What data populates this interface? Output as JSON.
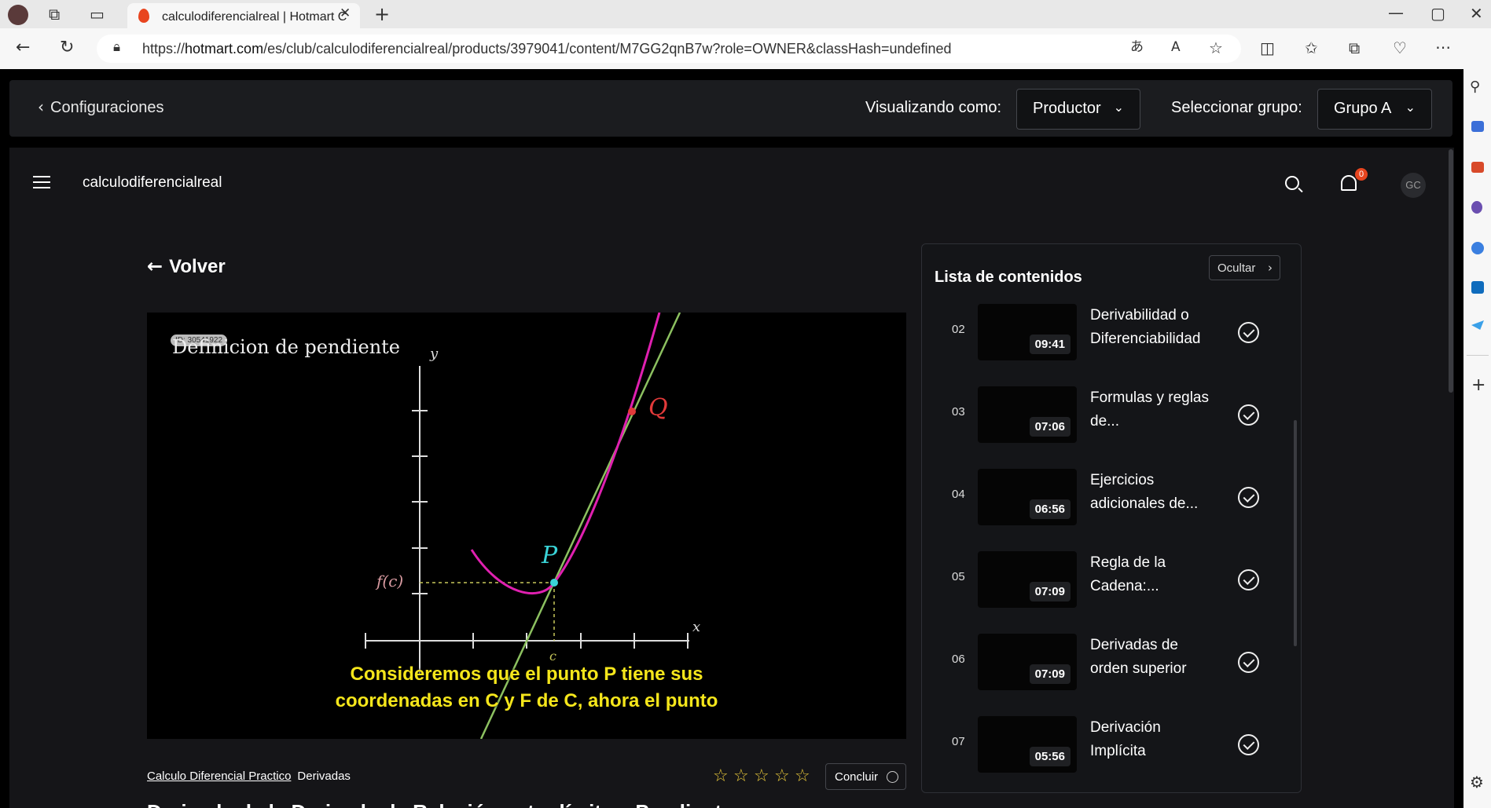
{
  "browser": {
    "tab_title": "calculodiferencialreal | Hotmart C",
    "url_prefix": "https://",
    "url_domain": "hotmart.com",
    "url_path": "/es/club/calculodiferencialreal/products/3979041/content/M7GG2qnB7w?role=OWNER&classHash=undefined"
  },
  "config_bar": {
    "back_label": "Configuraciones",
    "viewing_as_label": "Visualizando como:",
    "viewing_as_value": "Productor",
    "group_label": "Seleccionar grupo:",
    "group_value": "Grupo A"
  },
  "header": {
    "club_name": "calculodiferencialreal",
    "notification_count": "0",
    "avatar_initials": "GC"
  },
  "content": {
    "back_label": "Volver",
    "video": {
      "id_badge": "ID: 30541922",
      "slide_title": "Definicion de pendiente",
      "axis_y": "y",
      "axis_x": "x",
      "label_fc": "f(c)",
      "label_c": "c",
      "label_p": "P",
      "label_q": "Q",
      "subtitle_line1": "Consideremos que el punto P tiene sus",
      "subtitle_line2": "coordenadas en C y F de C, ahora el punto"
    },
    "breadcrumb_course": "Calculo Diferencial Practico",
    "breadcrumb_module": "Derivadas",
    "rating_stars": 5,
    "rating_value": 0,
    "conclude_label": "Concluir",
    "lesson_title_partial": "Derivada de la Derivada: la Relación entre límite y Pendiente"
  },
  "sidebar": {
    "title": "Lista de contenidos",
    "hide_label": "Ocultar",
    "items": [
      {
        "num": "02",
        "title": "Derivabilidad o Diferenciabilidad",
        "duration": "09:41"
      },
      {
        "num": "03",
        "title": "Formulas y reglas de...",
        "duration": "07:06"
      },
      {
        "num": "04",
        "title": "Ejercicios adicionales de...",
        "duration": "06:56"
      },
      {
        "num": "05",
        "title": "Regla de la Cadena:...",
        "duration": "07:09"
      },
      {
        "num": "06",
        "title": "Derivadas de orden superior",
        "duration": "07:09"
      },
      {
        "num": "07",
        "title": "Derivación Implícita",
        "duration": "05:56"
      }
    ]
  },
  "colors": {
    "accent_red": "#e8451f",
    "curve": "#e020b0",
    "tangent": "#8cc060",
    "subtitle": "#f5e61b",
    "star": "#e8c83a"
  }
}
